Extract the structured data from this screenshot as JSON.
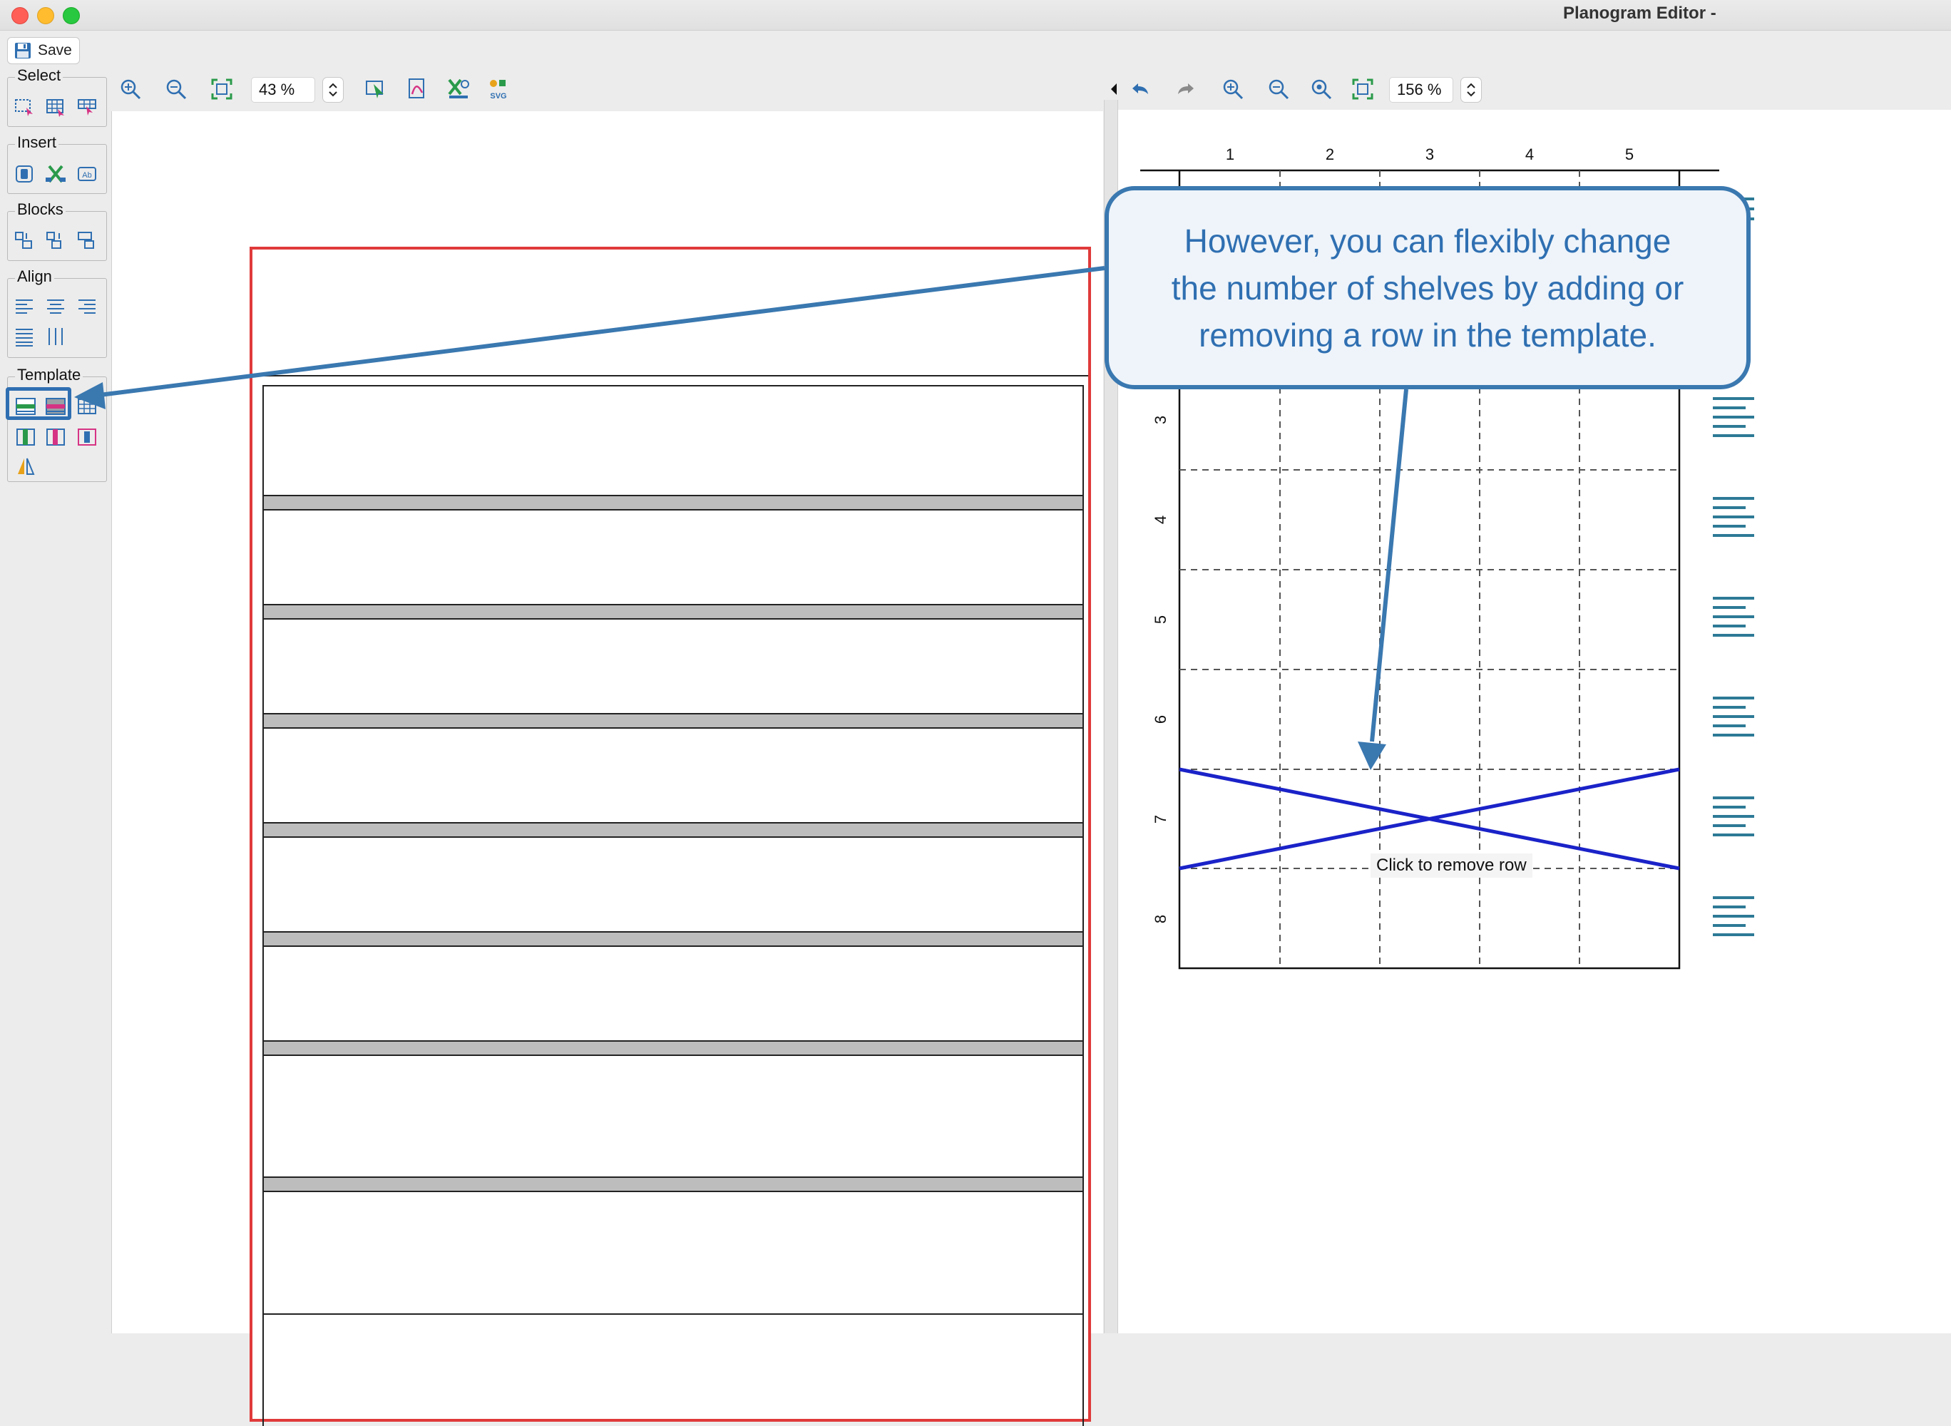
{
  "window": {
    "title": "Planogram Editor -"
  },
  "toolbar": {
    "save_label": "Save"
  },
  "palette": {
    "groups": [
      {
        "label": "Select"
      },
      {
        "label": "Insert"
      },
      {
        "label": "Blocks"
      },
      {
        "label": "Align"
      },
      {
        "label": "Template"
      }
    ]
  },
  "left_zoom": {
    "value": "43 %"
  },
  "right_zoom": {
    "value": "156 %"
  },
  "grid": {
    "columns": [
      "1",
      "2",
      "3",
      "4",
      "5"
    ],
    "rows": [
      "3",
      "4",
      "5",
      "6",
      "7",
      "8"
    ]
  },
  "callout": {
    "lines": [
      "However, you can flexibly change",
      "the number of shelves by adding or",
      "removing a row in the template."
    ]
  },
  "tooltip": {
    "text": "Click to remove row"
  },
  "colors": {
    "callout_accent": "#3a78b0",
    "planogram_border": "#e03a3a",
    "remove_row_cross": "#1a22c8",
    "shelf_fill": "#bdbdbd"
  }
}
